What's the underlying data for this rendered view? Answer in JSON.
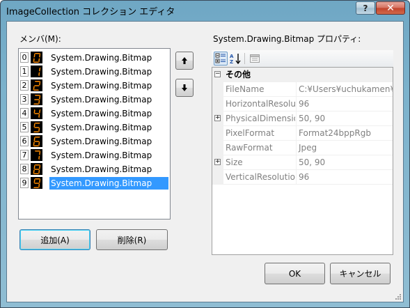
{
  "window": {
    "title": "ImageCollection コレクション エディタ",
    "help_label": "?",
    "close_label": "✕"
  },
  "members": {
    "label": "メンバ(M):",
    "items": [
      {
        "index": "0",
        "text": "System.Drawing.Bitmap",
        "glyph": "0"
      },
      {
        "index": "1",
        "text": "System.Drawing.Bitmap",
        "glyph": "1"
      },
      {
        "index": "2",
        "text": "System.Drawing.Bitmap",
        "glyph": "2"
      },
      {
        "index": "3",
        "text": "System.Drawing.Bitmap",
        "glyph": "3"
      },
      {
        "index": "4",
        "text": "System.Drawing.Bitmap",
        "glyph": "4"
      },
      {
        "index": "5",
        "text": "System.Drawing.Bitmap",
        "glyph": "5"
      },
      {
        "index": "6",
        "text": "System.Drawing.Bitmap",
        "glyph": "6"
      },
      {
        "index": "7",
        "text": "System.Drawing.Bitmap",
        "glyph": "7"
      },
      {
        "index": "8",
        "text": "System.Drawing.Bitmap",
        "glyph": "8"
      },
      {
        "index": "9",
        "text": "System.Drawing.Bitmap",
        "glyph": "9"
      }
    ],
    "selected_index": 9,
    "add_label": "追加(A)",
    "remove_label": "削除(R)"
  },
  "properties": {
    "header": "System.Drawing.Bitmap プロパティ:",
    "category": "その他",
    "rows": [
      {
        "name": "FileName",
        "value": "C:¥Users¥uchukamen¥",
        "expandable": false
      },
      {
        "name": "HorizontalResolut",
        "value": "96",
        "expandable": false
      },
      {
        "name": "PhysicalDimensio",
        "value": "50, 90",
        "expandable": true
      },
      {
        "name": "PixelFormat",
        "value": "Format24bppRgb",
        "expandable": false
      },
      {
        "name": "RawFormat",
        "value": "Jpeg",
        "expandable": false
      },
      {
        "name": "Size",
        "value": "50, 90",
        "expandable": true
      },
      {
        "name": "VerticalResolution",
        "value": "96",
        "expandable": false
      }
    ]
  },
  "footer": {
    "ok_label": "OK",
    "cancel_label": "キャンセル"
  },
  "colors": {
    "selection": "#3399ff",
    "digit_fill": "#ff8c00",
    "thumb_bg": "#000000"
  }
}
